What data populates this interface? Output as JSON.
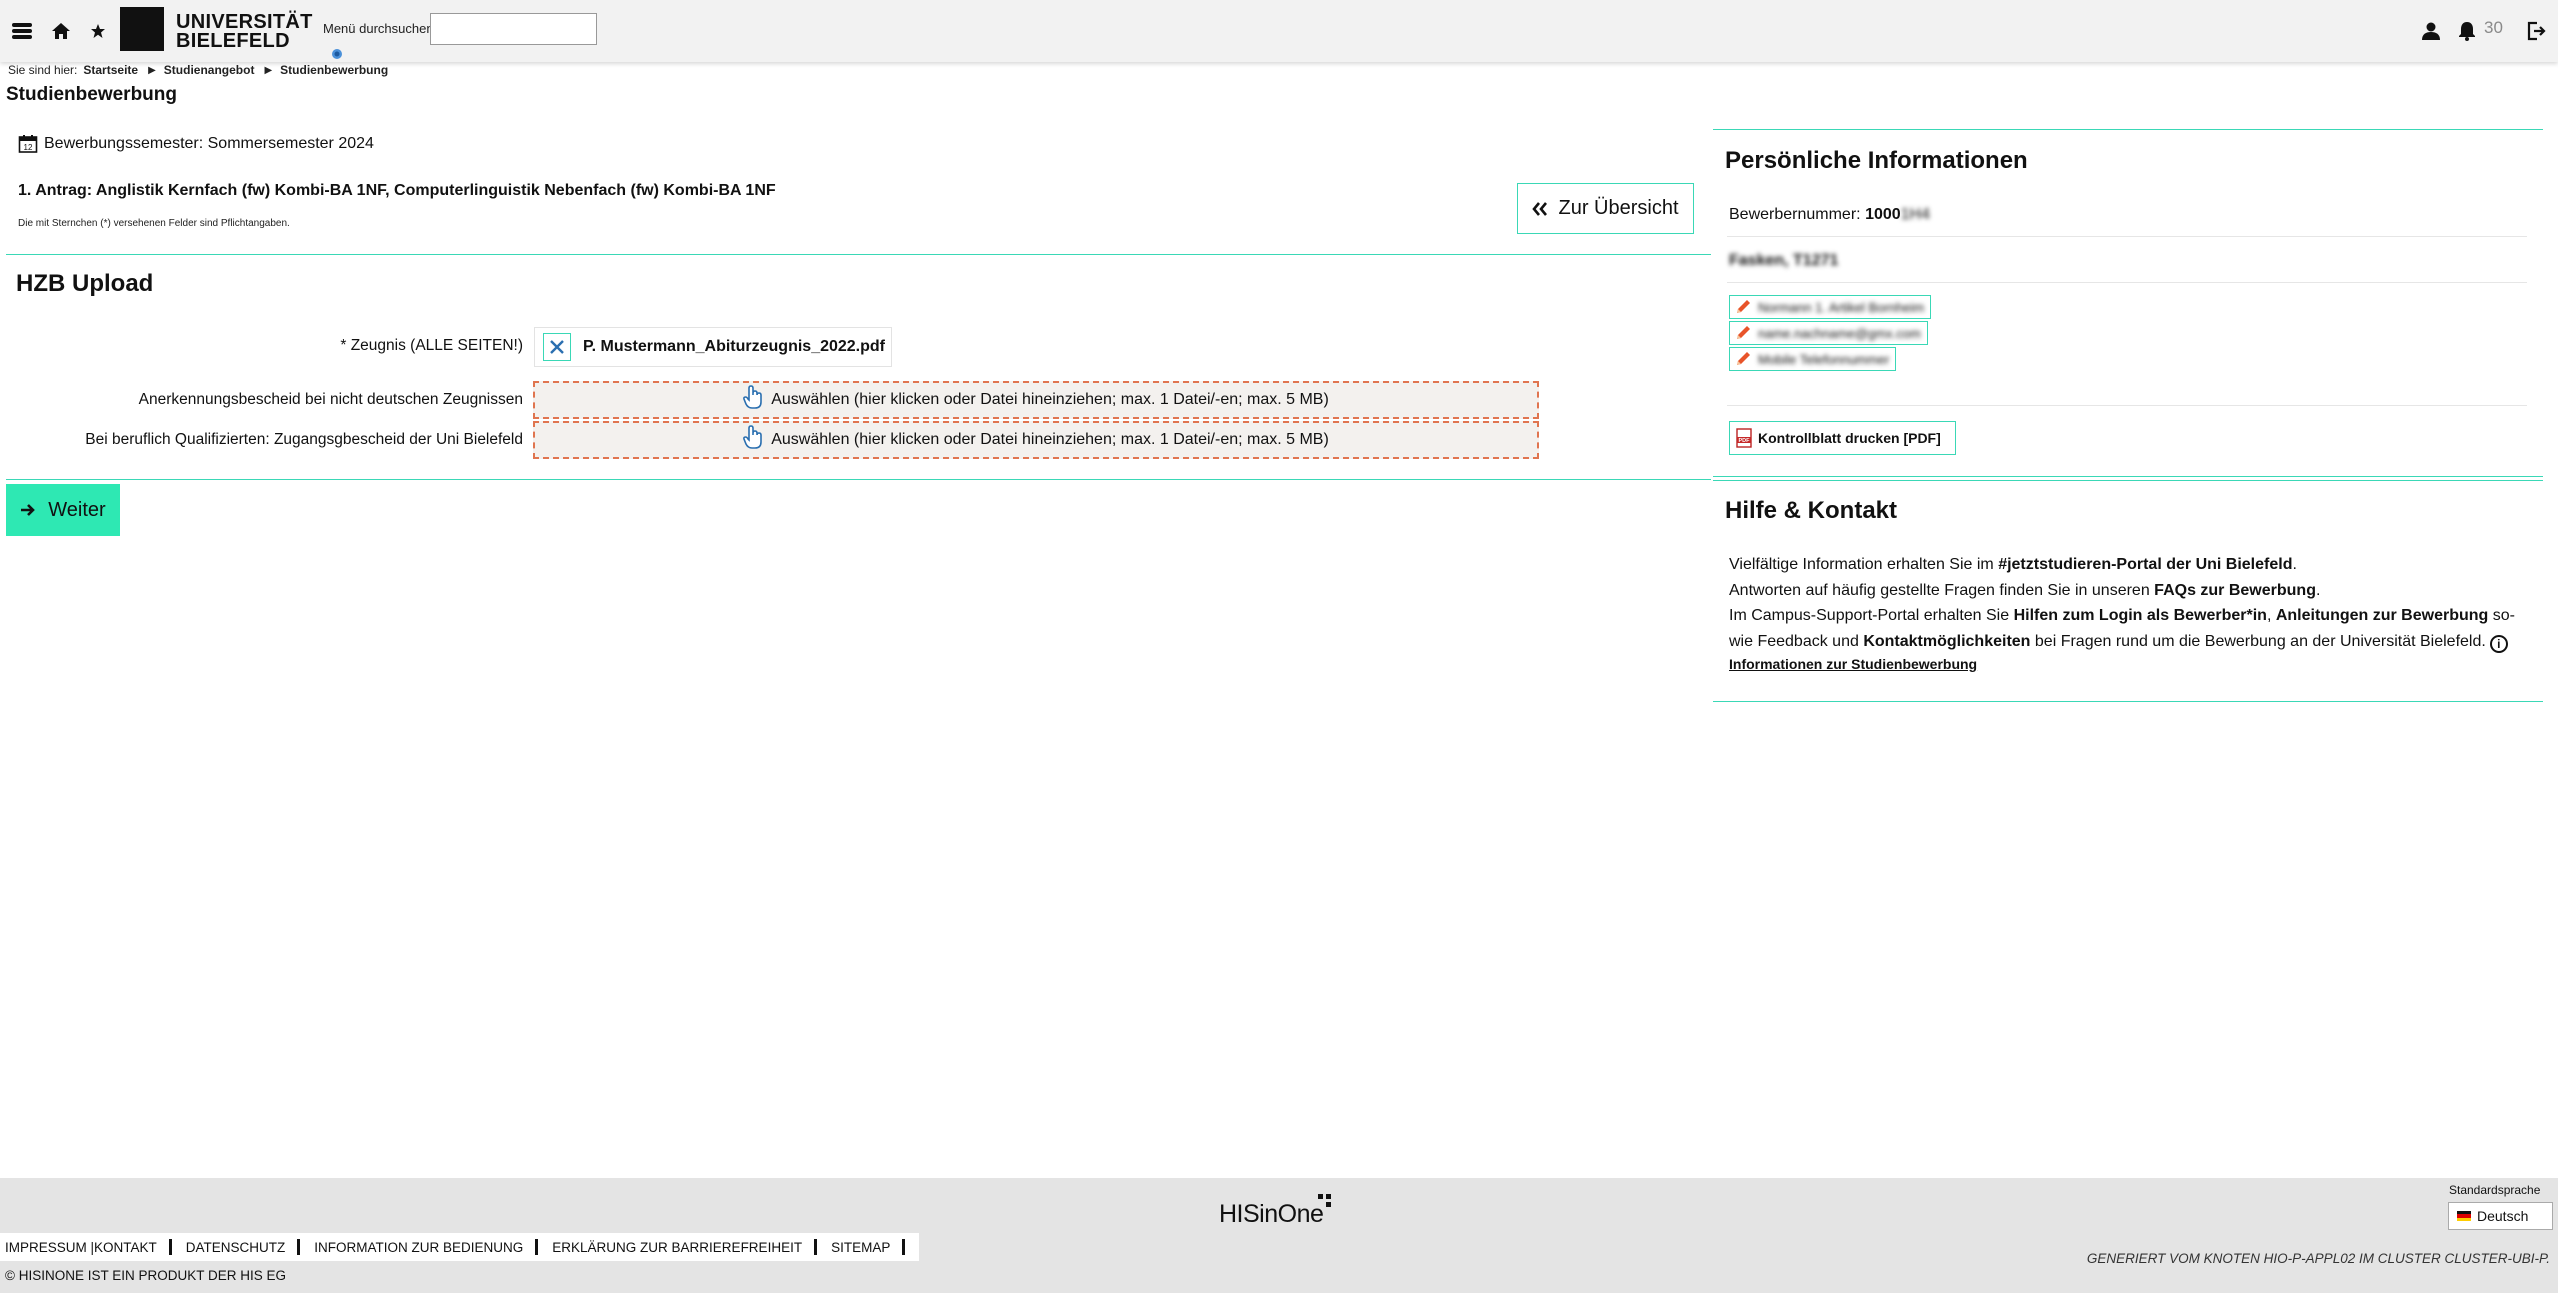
{
  "header": {
    "university_line1": "UNIVERSITÄT",
    "university_line2": "BIELEFELD",
    "menu_search_label": "Menü durchsuchen",
    "menu_search_value": "",
    "notification_count": "30"
  },
  "breadcrumb": {
    "prefix": "Sie sind hier:",
    "items": [
      "Startseite",
      "Studienangebot",
      "Studienbewerbung"
    ]
  },
  "page_title": "Studienbewerbung",
  "application": {
    "semester_text": "Bewerbungssemester: Sommersemester 2024",
    "title": "1. Antrag: Anglistik Kernfach (fw) Kombi-BA 1NF, Computerlinguistik Nebenfach (fw) Kombi-BA 1NF",
    "required_note": "Die mit Sternchen (*) versehenen Felder sind Pflichtangaben.",
    "overview_button": "Zur Übersicht"
  },
  "upload": {
    "section_title": "HZB Upload",
    "fields": [
      {
        "label": "* Zeugnis (ALLE SEITEN!)",
        "file": "P. Mustermann_Abiturzeugnis_2022.pdf"
      },
      {
        "label": "Anerkennungsbescheid bei nicht deutschen Zeugnissen",
        "dropzone": "Auswählen (hier klicken oder Datei hineinziehen; max. 1 Datei/-en; max. 5 MB)"
      },
      {
        "label": "Bei beruflich Qualifizierten: Zugangsgbescheid der Uni Bielefeld",
        "dropzone": "Auswählen (hier klicken oder Datei hineinziehen; max. 1 Datei/-en; max. 5 MB)"
      }
    ],
    "next_button": "Weiter"
  },
  "personal": {
    "title": "Persönliche Informationen",
    "applicant_label": "Bewerbernummer:",
    "applicant_number": "1000",
    "name": "Fasken, T1271",
    "address": "Normann 1. Artikel Bornheim",
    "email": "name.nachname@gmx.com",
    "phone": "Mobile Telefonnummer",
    "print_button": "Kontrollblatt drucken [PDF]"
  },
  "help": {
    "title": "Hilfe & Kontakt",
    "line1_pre": "Vielfältige Information erhalten Sie im ",
    "line1_link": "#jetztstudieren-Portal der Uni Bielefeld",
    "line1_post": ".",
    "line2_pre": "Antworten auf häufig gestellte Fragen finden Sie in unseren ",
    "line2_link": "FAQs zur Bewerbung",
    "line2_post": ".",
    "line3_pre": "Im Campus-Support-Portal erhalten Sie ",
    "line3_link1": "Hilfen zum Login als Bewerber*in",
    "line3_mid": ", ",
    "line3_link2": "Anleitungen zur Bewerbung",
    "line3_mid2": " so-wie Feedback und ",
    "line3_link3": "Kontaktmöglichkeiten",
    "line3_post": " bei Fragen rund um die Bewerbung an der Universität Bielefeld.",
    "info_link": "Informationen zur Studienbewerbung"
  },
  "footer": {
    "logo_text": "HISinOne",
    "language_label": "Standardsprache",
    "language_value": "Deutsch",
    "links": [
      "Impressum |Kontakt",
      "Datenschutz",
      "Information zur Bedienung",
      "Erklärung zur Barrierefreiheit",
      "Sitemap"
    ],
    "copyright": "© HISINONE IST EIN PRODUKT DER HIS EG",
    "node_info": "GENERIERT VOM KNOTEN HIO-P-APPL02 IM CLUSTER CLUSTER-UBI-P."
  },
  "colors": {
    "accent_teal": "#3ad8b6",
    "button_green": "#2ee8b3",
    "dropzone_border": "#e0754f",
    "pencil_orange": "#e8542a",
    "icon_blue": "#2a6fb0"
  }
}
